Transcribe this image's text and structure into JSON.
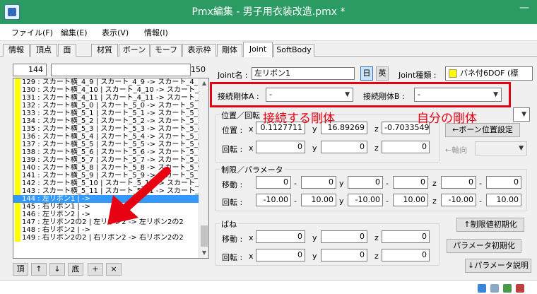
{
  "window": {
    "title": "Pmx編集 - 男子用衣装改造.pmx *",
    "minimize_glyph": "—"
  },
  "menu": [
    "ファイル(F)",
    "編集(E)",
    "表示(V)",
    "情報(I)"
  ],
  "tabs": [
    "情報",
    "頂点",
    "面",
    "材質",
    "ボーン",
    "モーフ",
    "表示枠",
    "剛体",
    "Joint",
    "SoftBody"
  ],
  "active_tab": "Joint",
  "list_header": {
    "index": "144",
    "name": "",
    "count": "150"
  },
  "joint_list": [
    "129 : スカート横_4_9 | スカート_4_9 -> スカート_4_",
    "130 : スカート横_4_10 | スカート_4_10 -> スカート_",
    "131 : スカート横_4_11 | スカート_4_11 -> スカート_",
    "132 : スカート横_5_0 | スカート_5_0 -> スカート_5_1",
    "133 : スカート横_5_1 | スカート_5_1 -> スカート_5_2",
    "134 : スカート横_5_2 | スカート_5_2 -> スカート_5_3",
    "135 : スカート横_5_3 | スカート_5_3 -> スカート_5_4",
    "136 : スカート横_5_4 | スカート_5_4 -> スカート_5_5",
    "137 : スカート横_5_5 | スカート_5_5 -> スカート_5_6",
    "138 : スカート横_5_6 | スカート_5_6 -> スカート_5_7",
    "139 : スカート横_5_7 | スカート_5_7 -> スカート_5_8",
    "140 : スカート横_5_8 | スカート_5_8 -> スカート_5_9",
    "141 : スカート横_5_9 | スカート_5_9 -> スカート_5_",
    "142 : スカート横_5_10 | スカート_5_10 -> スカート_",
    "143 : スカート横_5_11 | スカート_5_11 -> スカート_",
    "144 : 左リボン1 | ->",
    "145 : 右リボン1 | ->",
    "146 : 左リボン2 | ->",
    "147 : 左リボン2の2 | 左リボン2 -> 左リボン2の2",
    "148 : 右リボン2 | ->",
    "149 : 右リボン2の2 | 右リボン2 -> 右リボン2の2"
  ],
  "selected_row": "144 : 左リボン1 | ->",
  "nav_buttons": [
    "頂",
    "↑",
    "↓",
    "底",
    "+",
    "×"
  ],
  "joint": {
    "name_label": "Joint名 :",
    "name_value": "左リボン1",
    "lang_jp": "日",
    "lang_en": "英",
    "type_label": "Joint種類 :",
    "type_value": "バネ付6DOF (標",
    "type_color": "#ffff00",
    "rigid_a_label": "接続剛体A :",
    "rigid_a_value": "-",
    "rigid_b_label": "接続剛体B :",
    "rigid_b_value": "-"
  },
  "position_group": {
    "title": "位置／回転",
    "pos_label": "位置 :",
    "rot_label": "回転 :",
    "x": "x",
    "y": "y",
    "z": "z",
    "pos": [
      "0.1127711",
      "16.89269",
      "-0.7033549"
    ],
    "rot": [
      "0",
      "0",
      "0"
    ],
    "bone_pos_button": "←ボーン位置設定",
    "axis_label": "←軸向"
  },
  "limit_group": {
    "title": "制限／パラメータ",
    "move_label": "移動 :",
    "rot_label": "回転 :",
    "dash": "-",
    "move": [
      "0",
      "0",
      "0",
      "0",
      "0",
      "0"
    ],
    "rot": [
      "-10.00",
      "10.00",
      "-10.00",
      "10.00",
      "-10.00",
      "10.00"
    ]
  },
  "spring_group": {
    "title": "ばね",
    "move_label": "移動 :",
    "rot_label": "回転 :",
    "move": [
      "0",
      "0",
      "0"
    ],
    "rot": [
      "0",
      "0",
      "0"
    ]
  },
  "buttons": {
    "limit_init": "↑制限値初期化",
    "param_init": "パラメータ初期化",
    "param_help": "↓パラメータ説明"
  },
  "annotations": {
    "connect_rigid": "接続する剛体",
    "own_rigid": "自分の剛体"
  },
  "colors": {
    "titlebar": "#2c9a63",
    "annotation": "#e60012",
    "selection": "#3399ff"
  }
}
